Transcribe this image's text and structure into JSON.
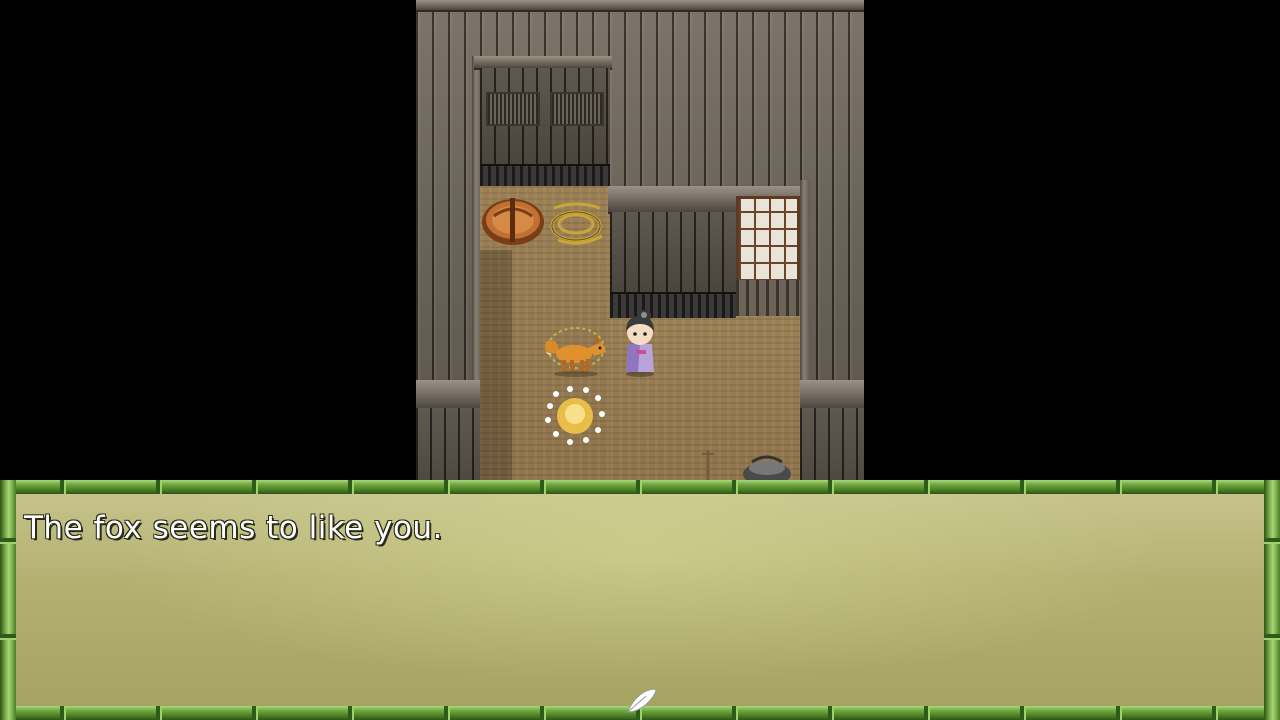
{
  "scene": {
    "location": "",
    "sprites": {
      "player": "player-girl-sprite",
      "fox": "fox-sprite",
      "sparkle": "sparkle-icon",
      "barrel": "barrel-icon",
      "rope": "rope-icon",
      "pot": "pot-icon"
    }
  },
  "dialog": {
    "message": "The fox seems to like you.",
    "continue_icon": "feather-cursor-icon"
  },
  "colors": {
    "dialog_bg": "#b3b172",
    "bamboo": "#6ea43f",
    "text": "#ffffff",
    "wood": "#6a6358",
    "floor": "#8e734b"
  }
}
